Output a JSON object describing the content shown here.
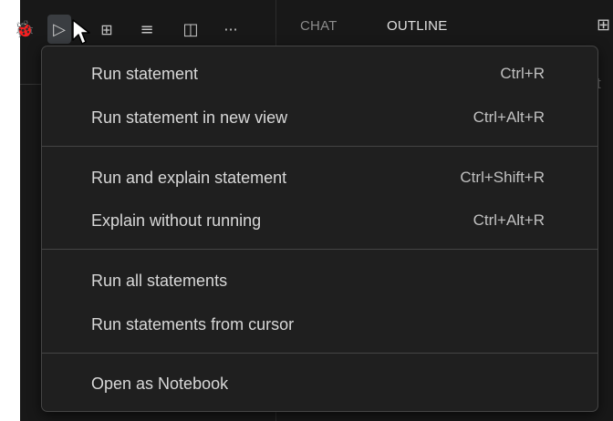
{
  "toolbar": {
    "icons": [
      {
        "name": "debug-icon",
        "glyph": "🐞"
      },
      {
        "name": "run-icon",
        "glyph": "▷"
      },
      {
        "name": "variables-icon",
        "glyph": "⊞"
      },
      {
        "name": "clear-format-icon",
        "glyph": "≡"
      },
      {
        "name": "split-editor-icon",
        "glyph": "◫"
      },
      {
        "name": "more-actions-icon",
        "glyph": "···"
      }
    ]
  },
  "panel": {
    "tabs": [
      {
        "label": "CHAT",
        "active": false
      },
      {
        "label": "OUTLINE",
        "active": true
      }
    ],
    "edge_letter": "t",
    "corner_icon": "⊞"
  },
  "menu": {
    "groups": [
      [
        {
          "label": "Run statement",
          "shortcut": "Ctrl+R"
        },
        {
          "label": "Run statement in new view",
          "shortcut": "Ctrl+Alt+R"
        }
      ],
      [
        {
          "label": "Run and explain statement",
          "shortcut": "Ctrl+Shift+R"
        },
        {
          "label": "Explain without running",
          "shortcut": "Ctrl+Alt+R"
        }
      ],
      [
        {
          "label": "Run all statements",
          "shortcut": ""
        },
        {
          "label": "Run statements from cursor",
          "shortcut": ""
        }
      ],
      [
        {
          "label": "Open as Notebook",
          "shortcut": ""
        }
      ]
    ]
  },
  "colors": {
    "background": "#181818",
    "menu_background": "#1f1f1f",
    "menu_border": "#454545",
    "text": "#d8d8d8",
    "active_tab": "#e0e0e0",
    "inactive_tab": "#8b8b8b"
  }
}
